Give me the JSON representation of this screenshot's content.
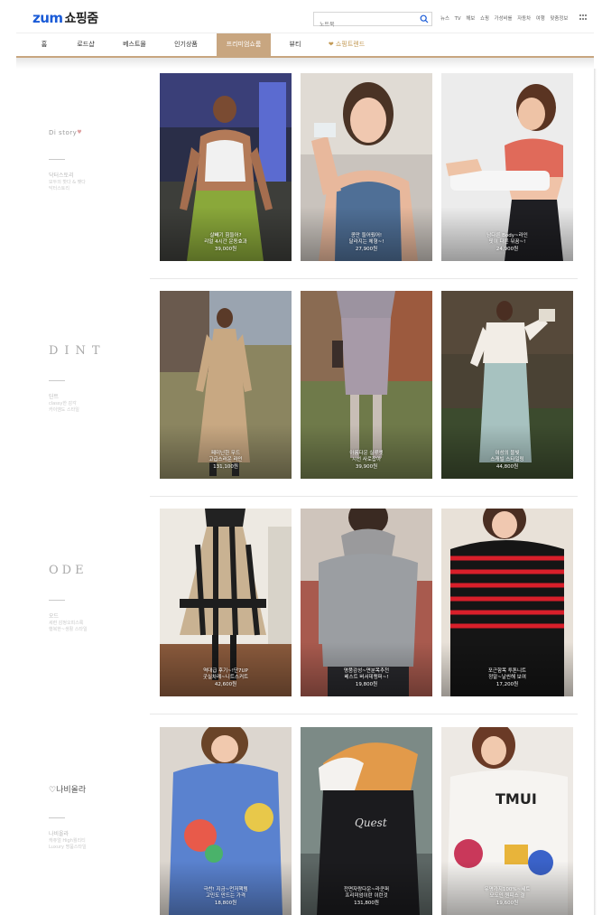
{
  "header": {
    "logo_brand": "zum",
    "logo_sub": "쇼핑줌",
    "search_placeholder": "노트북",
    "top_links": [
      "뉴스",
      "TV",
      "해보",
      "쇼핑",
      "가성비를",
      "자동차",
      "여행",
      "맞춤정보"
    ]
  },
  "nav": {
    "items": [
      "홈",
      "로드샵",
      "베스트몰",
      "인기상품",
      "프리미엄쇼룸",
      "뷰티",
      "❤ 쇼핑트렌드"
    ],
    "active_index": 4,
    "accent_color": "#c8a680"
  },
  "sections": [
    {
      "brand_logo": "Di story",
      "brand_name": "닥터스토리",
      "brand_desc": [
        "모두의 핫다 & 팻다",
        "닥터스토리"
      ],
      "products": [
        {
          "caption": [
            "살빼기 힘들어?",
            "리얼 4시간 운동효과"
          ],
          "price": "39,000원"
        },
        {
          "caption": [
            "콩만 들어줬어!",
            "달라지는 체형~!"
          ],
          "price": "27,900원"
        },
        {
          "caption": [
            "남다른 Body~라인",
            "핏이 다른 뒤꿈~!"
          ],
          "price": "24,900원"
        }
      ]
    },
    {
      "brand_logo": "DINT",
      "brand_name": "딘트",
      "brand_desc": [
        "classy한 감각",
        "카이엠도 스타일"
      ],
      "products": [
        {
          "caption": [
            "페미닌한 무드",
            "고급스러운 라인"
          ],
          "price": "131,100원"
        },
        {
          "caption": [
            "아름다운 실루엣",
            "시선 사로잡아"
          ],
          "price": "39,900원"
        },
        {
          "caption": [
            "여성의 물빛",
            "스캐빌 스타일링"
          ],
          "price": "44,800원"
        }
      ]
    },
    {
      "brand_logo": "ODE",
      "brand_name": "오드",
      "brand_desc": [
        "세련 감정오피스룩",
        "행복한~생활 스타일"
      ],
      "products": [
        {
          "caption": [
            "역대급 후기~!단7UP",
            "굿실차례~니트스커트"
          ],
          "price": "42,600원"
        },
        {
          "caption": [
            "명품감성~면분목추천",
            "베스트 버서데랭퍼~!"
          ],
          "price": "19,800원"
        },
        {
          "caption": [
            "포근함목 투톤니트",
            "정말~날씬해 보여"
          ],
          "price": "17,200원"
        }
      ]
    },
    {
      "brand_logo": "나비올라",
      "brand_name": "나비올라",
      "brand_desc": [
        "캐쥬얼 High퀄리티",
        "Luxury 명품스타일"
      ],
      "products": [
        {
          "caption": [
            "극찬! 지금~먼저핵템",
            "고민도 만드는 가격"
          ],
          "price": "18,800원"
        },
        {
          "caption": [
            "전면자랑다운~라쿤퍼",
            "프리미엄이란 이런것"
          ],
          "price": "131,800원"
        },
        {
          "caption": [
            "유명가지100%~세트",
            "모도인 원피스 결"
          ],
          "price": "19,600원"
        }
      ]
    }
  ]
}
